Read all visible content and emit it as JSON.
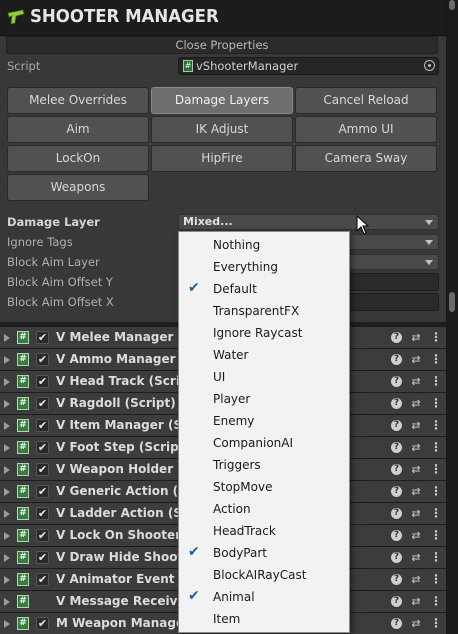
{
  "header": {
    "title": "SHOOTER MANAGER"
  },
  "close_properties": "Close Properties",
  "script": {
    "label": "Script",
    "value": "vShooterManager"
  },
  "tabs": [
    "Melee Overrides",
    "Damage Layers",
    "Cancel Reload",
    "Aim",
    "IK Adjust",
    "Ammo UI",
    "LockOn",
    "HipFire",
    "Camera Sway",
    "Weapons"
  ],
  "active_tab": "Damage Layers",
  "properties": {
    "damage_layer": {
      "label": "Damage Layer",
      "value": "Mixed..."
    },
    "ignore_tags": {
      "label": "Ignore Tags"
    },
    "block_aim_layer": {
      "label": "Block Aim Layer"
    },
    "block_aim_offset_y": {
      "label": "Block Aim Offset Y"
    },
    "block_aim_offset_x": {
      "label": "Block Aim Offset X"
    }
  },
  "components": [
    {
      "name": "V Melee Manager (Sc",
      "enabled": true,
      "script_icon": true
    },
    {
      "name": "V Ammo Manager (S",
      "enabled": true,
      "script_icon": true
    },
    {
      "name": "V Head Track (Script",
      "enabled": true,
      "script_icon": true
    },
    {
      "name": "V Ragdoll (Script)",
      "enabled": true,
      "script_icon": true
    },
    {
      "name": "V Item Manager (Sc",
      "enabled": true,
      "script_icon": true
    },
    {
      "name": "V Foot Step (Script)",
      "enabled": true,
      "script_icon": true
    },
    {
      "name": "V Weapon Holder M",
      "enabled": true,
      "script_icon": true
    },
    {
      "name": "V Generic Action (Sc",
      "enabled": true,
      "script_icon": true
    },
    {
      "name": "V Ladder Action (Sc",
      "enabled": true,
      "script_icon": true
    },
    {
      "name": "V Lock On Shooter (",
      "enabled": true,
      "script_icon": true
    },
    {
      "name": "V Draw Hide Shoote",
      "enabled": true,
      "script_icon": true
    },
    {
      "name": "V Animator Event R",
      "enabled": true,
      "script_icon": true
    },
    {
      "name": "V Message Receiver",
      "enabled": false,
      "script_icon": true
    },
    {
      "name": "M Weapon Manager",
      "enabled": true,
      "script_icon": true
    }
  ],
  "layer_options": [
    {
      "label": "Nothing",
      "checked": false
    },
    {
      "label": "Everything",
      "checked": false
    },
    {
      "label": "Default",
      "checked": true
    },
    {
      "label": "TransparentFX",
      "checked": false
    },
    {
      "label": "Ignore Raycast",
      "checked": false
    },
    {
      "label": "Water",
      "checked": false
    },
    {
      "label": "UI",
      "checked": false
    },
    {
      "label": "Player",
      "checked": false
    },
    {
      "label": "Enemy",
      "checked": false
    },
    {
      "label": "CompanionAI",
      "checked": false
    },
    {
      "label": "Triggers",
      "checked": false
    },
    {
      "label": "StopMove",
      "checked": false
    },
    {
      "label": "Action",
      "checked": false
    },
    {
      "label": "HeadTrack",
      "checked": false
    },
    {
      "label": "BodyPart",
      "checked": true
    },
    {
      "label": "BlockAIRayCast",
      "checked": false
    },
    {
      "label": "Animal",
      "checked": true
    },
    {
      "label": "Item",
      "checked": false
    }
  ],
  "icons": {
    "checkmark": "✔",
    "script": "#",
    "help": "?",
    "preset": "⇄",
    "menu": "⋮"
  },
  "colors": {
    "panel_bg": "#383838",
    "popup_bg": "#f2f2f2",
    "check_blue": "#1f5fa8",
    "script_icon_green": "#3b7a45"
  }
}
